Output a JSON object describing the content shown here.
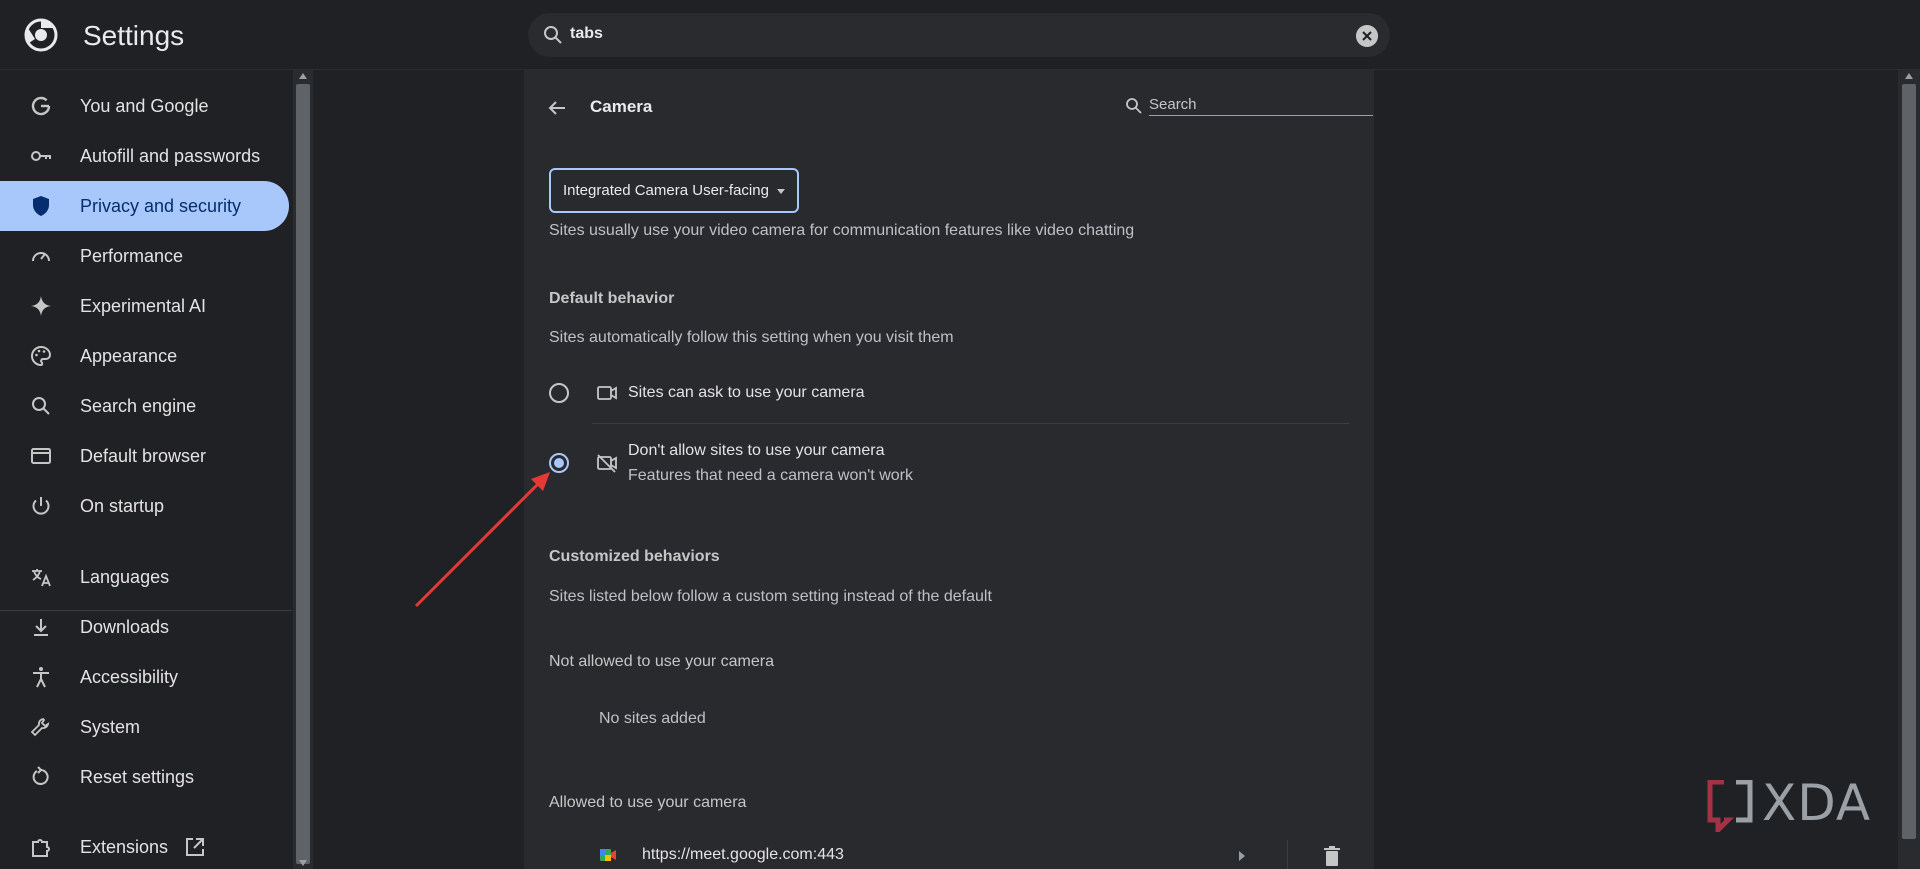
{
  "app": {
    "title": "Settings"
  },
  "search": {
    "value": "tabs"
  },
  "sidebar": {
    "items": [
      {
        "label": "You and Google",
        "icon": "google-icon"
      },
      {
        "label": "Autofill and passwords",
        "icon": "key-icon"
      },
      {
        "label": "Privacy and security",
        "icon": "shield-icon",
        "active": true
      },
      {
        "label": "Performance",
        "icon": "speedometer-icon"
      },
      {
        "label": "Experimental AI",
        "icon": "sparkle-icon"
      },
      {
        "label": "Appearance",
        "icon": "palette-icon"
      },
      {
        "label": "Search engine",
        "icon": "search-icon"
      },
      {
        "label": "Default browser",
        "icon": "browser-window-icon"
      },
      {
        "label": "On startup",
        "icon": "power-icon"
      },
      {
        "label": "Languages",
        "icon": "translate-icon"
      },
      {
        "label": "Downloads",
        "icon": "download-icon"
      },
      {
        "label": "Accessibility",
        "icon": "accessibility-icon"
      },
      {
        "label": "System",
        "icon": "wrench-icon"
      },
      {
        "label": "Reset settings",
        "icon": "reset-icon"
      },
      {
        "label": "Extensions",
        "icon": "puzzle-icon"
      }
    ]
  },
  "camera": {
    "title": "Camera",
    "search_placeholder": "Search",
    "device_selected": "Integrated Camera User-facing",
    "description": "Sites usually use your video camera for communication features like video chatting",
    "default_heading": "Default behavior",
    "default_desc": "Sites automatically follow this setting when you visit them",
    "option_allow": "Sites can ask to use your camera",
    "option_block": "Don't allow sites to use your camera",
    "option_block_sub": "Features that need a camera won't work",
    "custom_heading": "Customized behaviors",
    "custom_desc": "Sites listed below follow a custom setting instead of the default",
    "not_allowed_heading": "Not allowed to use your camera",
    "no_sites": "No sites added",
    "allowed_heading": "Allowed to use your camera",
    "allowed_site": "https://meet.google.com:443"
  },
  "watermark": {
    "text": "XDA"
  },
  "colors": {
    "accent": "#a8c7fa",
    "annotation_arrow": "#e53935"
  }
}
